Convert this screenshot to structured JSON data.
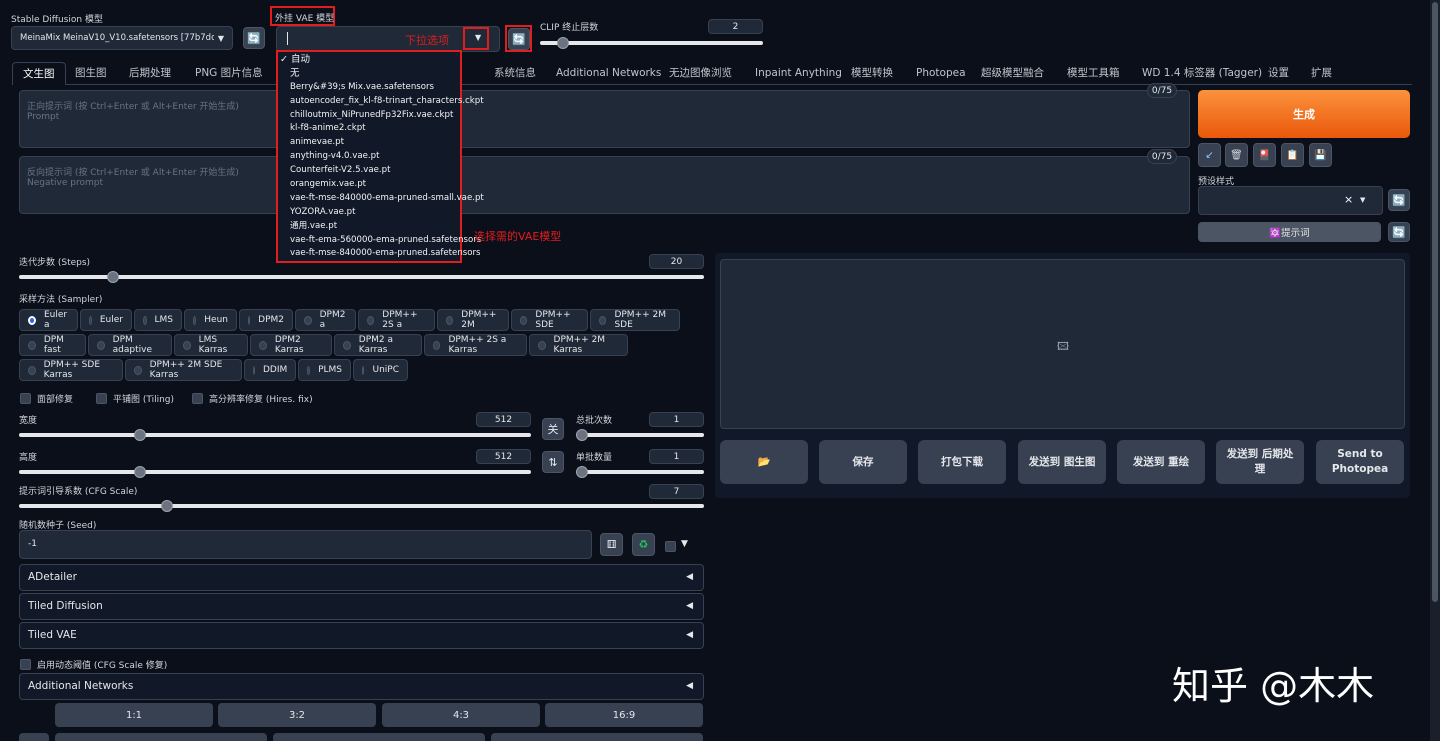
{
  "top": {
    "sd_model_label": "Stable Diffusion 模型",
    "sd_model_value": "MeinaMix MeinaV10_V10.safetensors [77b7dc4e",
    "vae_label": "外挂 VAE 模型",
    "vae_dropdown_hint": "下拉选项",
    "clip_label": "CLIP 终止层数",
    "clip_value": "2",
    "clip_fraction": 0.08
  },
  "vae_dropdown": {
    "items": [
      "✓ 自动",
      "无",
      "Berry&#39;s Mix.vae.safetensors",
      "autoencoder_fix_kl-f8-trinart_characters.ckpt",
      "chilloutmix_NiPrunedFp32Fix.vae.ckpt",
      "kl-f8-anime2.ckpt",
      "animevae.pt",
      "anything-v4.0.vae.pt",
      "Counterfeit-V2.5.vae.pt",
      "orangemix.vae.pt",
      "vae-ft-mse-840000-ema-pruned-small.vae.pt",
      "YOZORA.vae.pt",
      "通用.vae.pt",
      "vae-ft-ema-560000-ema-pruned.safetensors",
      "vae-ft-mse-840000-ema-pruned.safetensors"
    ],
    "annotation": "选择需的VAE模型"
  },
  "tabs": [
    "文生图",
    "图生图",
    "后期处理",
    "PNG 图片信息",
    "系统信息",
    "Additional Networks",
    "无边图像浏览",
    "Inpaint Anything",
    "模型转换",
    "Photopea",
    "超级模型融合",
    "模型工具箱",
    "WD 1.4 标签器 (Tagger)",
    "设置",
    "扩展"
  ],
  "prompt": {
    "placeholder_line1": "正向提示词 (按 Ctrl+Enter 或 Alt+Enter 开始生成)",
    "placeholder_line2": "Prompt",
    "counter": "0/75"
  },
  "negative": {
    "placeholder_line1": "反向提示词 (按 Ctrl+Enter 或 Alt+Enter 开始生成)",
    "placeholder_line2": "Negative prompt",
    "counter": "0/75"
  },
  "generate_label": "生成",
  "toolbar_icons": [
    "arrow-icon",
    "trash-icon",
    "card-icon",
    "clipboard-icon",
    "save-icon"
  ],
  "styles_label": "预设样式",
  "style_clear": "×",
  "prompt_btn": "🔯提示词",
  "steps": {
    "label": "迭代步数 (Steps)",
    "value": "20",
    "fraction": 0.13
  },
  "sampler": {
    "label": "采样方法 (Sampler)",
    "row1": [
      "Euler a",
      "Euler",
      "LMS",
      "Heun",
      "DPM2",
      "DPM2 a",
      "DPM++ 2S a",
      "DPM++ 2M",
      "DPM++ SDE",
      "DPM++ 2M SDE"
    ],
    "row2": [
      "DPM fast",
      "DPM adaptive",
      "LMS Karras",
      "DPM2 Karras",
      "DPM2 a Karras",
      "DPM++ 2S a Karras",
      "DPM++ 2M Karras"
    ],
    "row3": [
      "DPM++ SDE Karras",
      "DPM++ 2M SDE Karras",
      "DDIM",
      "PLMS",
      "UniPC"
    ],
    "selected": "Euler a"
  },
  "checks": [
    "面部修复",
    "平铺图 (Tiling)",
    "高分辨率修复 (Hires. fix)"
  ],
  "width": {
    "label": "宽度",
    "value": "512",
    "fraction": 0.23
  },
  "height": {
    "label": "高度",
    "value": "512",
    "fraction": 0.23
  },
  "swap_label": "关",
  "swap_icon": "⇅",
  "batch_count": {
    "label": "总批次数",
    "value": "1",
    "fraction": 0.0
  },
  "batch_size": {
    "label": "单批数量",
    "value": "1",
    "fraction": 0.0
  },
  "cfg": {
    "label": "提示词引导系数 (CFG Scale)",
    "value": "7",
    "fraction": 0.21
  },
  "seed": {
    "label": "随机数种子 (Seed)",
    "value": "-1",
    "dice": "⚅",
    "recycle": "♻",
    "extra_arrow": "▼"
  },
  "accordions": [
    "ADetailer",
    "Tiled Diffusion",
    "Tiled VAE"
  ],
  "accordion_arrow": "◀",
  "dyn_thresh": "启用动态阈值 (CFG Scale 修复)",
  "additional_networks": "Additional Networks",
  "ratios": [
    "1:1",
    "3:2",
    "4:3",
    "16:9"
  ],
  "output_buttons": [
    "📂",
    "保存",
    "打包下载",
    "发送到 图生图",
    "发送到 重绘",
    "发送到 后期处理",
    "Send to Photopea"
  ],
  "watermark": "知乎 @木木",
  "colors": {
    "bg": "#0b0f19",
    "panel": "#1f2937",
    "accent": "#f97316",
    "annot": "#e11d1d"
  }
}
